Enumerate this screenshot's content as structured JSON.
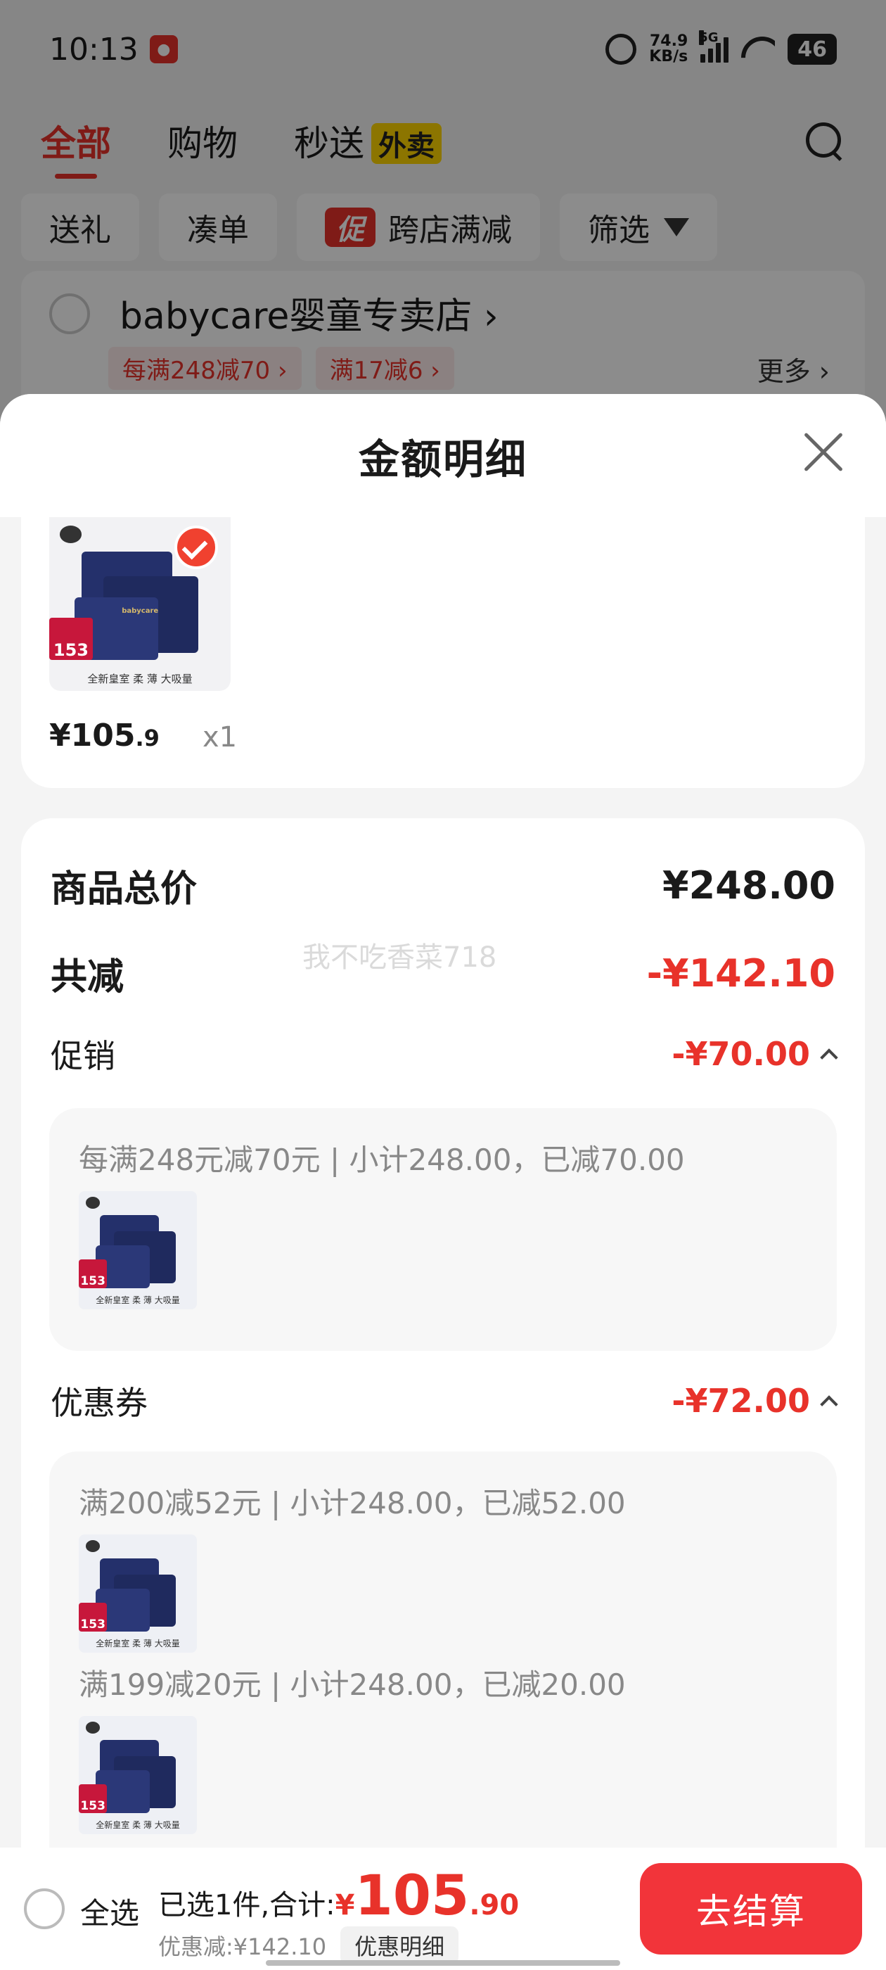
{
  "status_bar": {
    "time": "10:13",
    "net_speed_value": "74.9",
    "net_speed_unit": "KB/s",
    "network": "5G",
    "battery": "46"
  },
  "top_tabs": [
    {
      "label": "全部"
    },
    {
      "label": "购物"
    },
    {
      "label": "秒送"
    }
  ],
  "waimai_badge": "外卖",
  "filters": {
    "gift": "送礼",
    "coudan": "凑单",
    "promo_badge": "促",
    "cross_store": "跨店满减",
    "filter": "筛选"
  },
  "store": {
    "name": "babycare婴童专卖店",
    "arrow": "›",
    "tags": [
      "每满248减70 ›",
      "满17减6 ›"
    ],
    "more": "更多 ›"
  },
  "sheet": {
    "title": "金额明细"
  },
  "product": {
    "price_main": "¥105",
    "price_decimal": ".9",
    "qty": "x1",
    "tag_number": "153",
    "pack_caption": "全新皇室 柔 薄 大吸量",
    "brand": "babycare"
  },
  "summary": {
    "total_label": "商品总价",
    "total_value": "¥248.00",
    "reduce_label": "共减",
    "reduce_value": "-¥142.10",
    "promo_label": "促销",
    "promo_value": "-¥70.00",
    "promo_rule": "每满248元减70元 | 小计248.00，已减70.00",
    "coupon_label": "优惠券",
    "coupon_value": "-¥72.00",
    "coupon_rules": [
      "满200减52元 | 小计248.00，已减52.00",
      "满199减20元 | 小计248.00，已减20.00"
    ],
    "watermark": "我不吃香菜718"
  },
  "bottom_bar": {
    "select_all": "全选",
    "selected_text": "已选1件,合计:",
    "yen": "¥",
    "total_int": "105",
    "total_dec": ".90",
    "discount_text": "优惠减:¥142.10",
    "detail_button": "优惠明细",
    "checkout_button": "去结算"
  },
  "colors": {
    "accent_red": "#e8322a",
    "checkout_red": "#f2343a"
  }
}
